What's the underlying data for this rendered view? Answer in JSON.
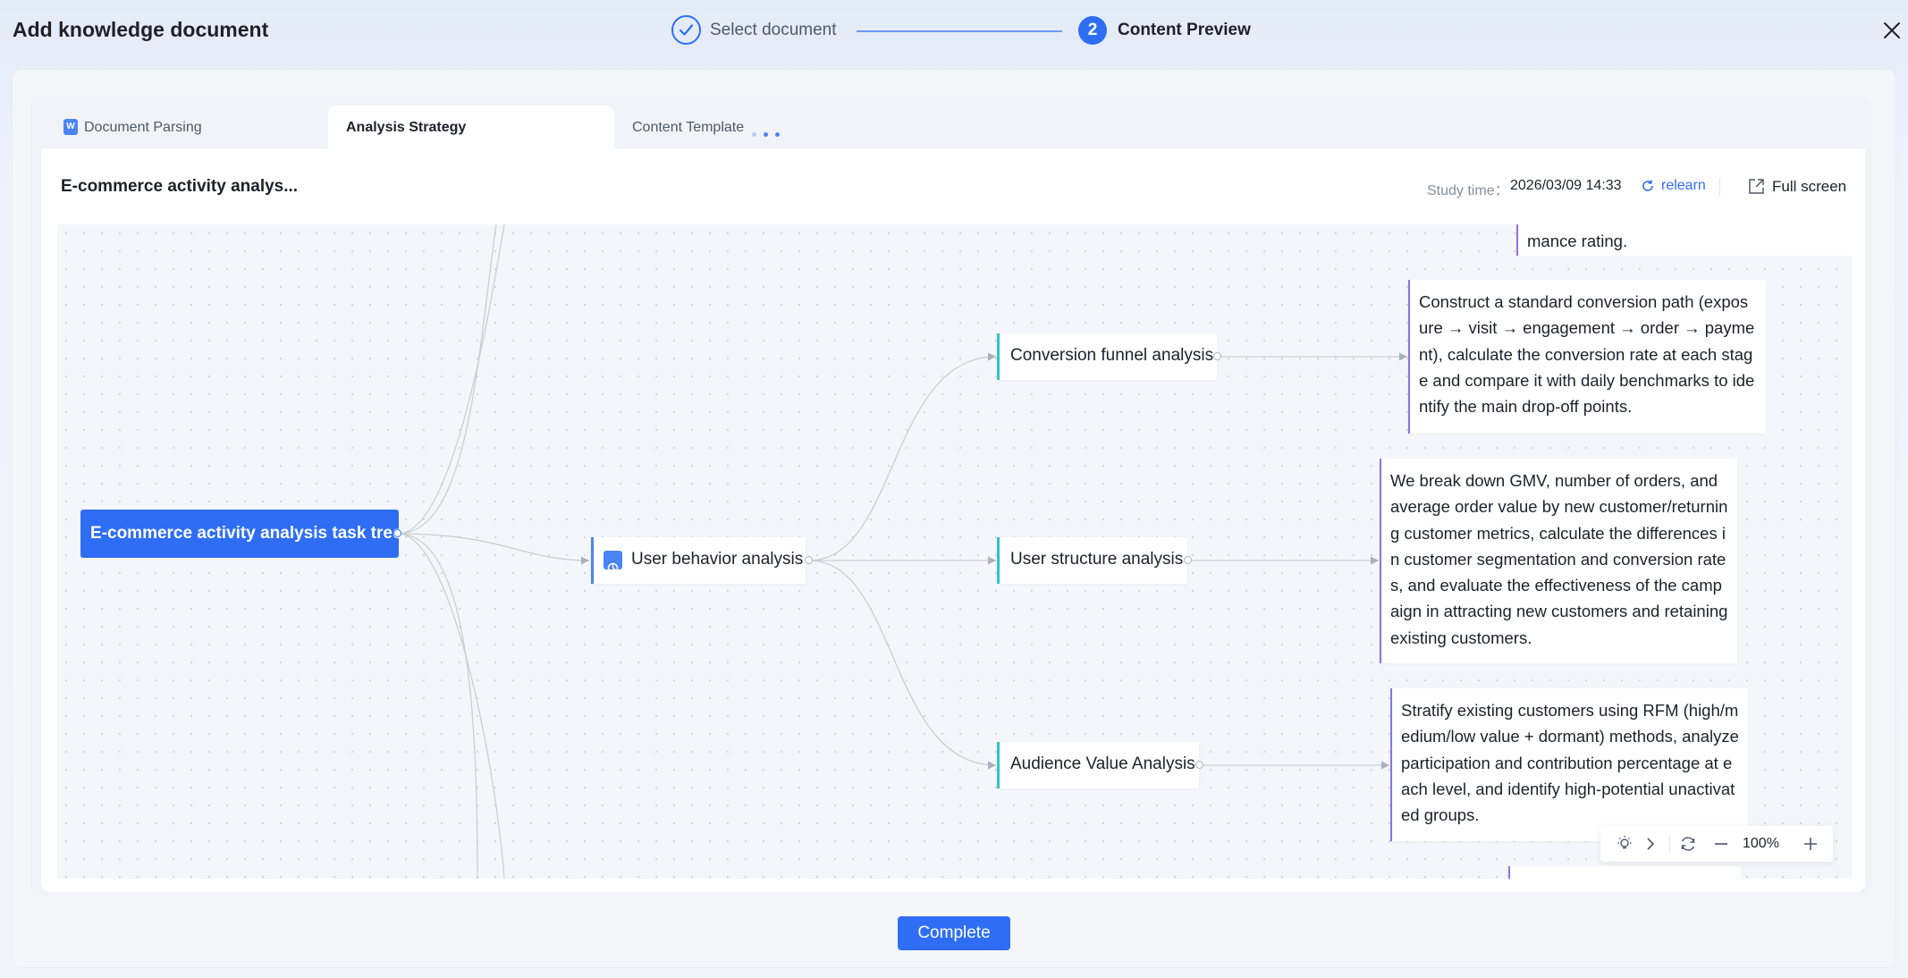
{
  "header": {
    "title": "Add knowledge document",
    "steps": [
      {
        "label": "Select document",
        "state": "done"
      },
      {
        "number": "2",
        "label": "Content Preview",
        "state": "active"
      }
    ]
  },
  "tabs": [
    {
      "label": "Document Parsing",
      "icon": "word-doc-icon",
      "icon_text": "W"
    },
    {
      "label": "Analysis Strategy",
      "active": true
    },
    {
      "label": "Content Template",
      "loading": true
    }
  ],
  "toolbar": {
    "document_title": "E-commerce activity analys...",
    "study_label": "Study time：",
    "study_time": "2026/03/09 14:33",
    "relearn": "relearn",
    "full_screen": "Full screen"
  },
  "tree": {
    "root": "E-commerce activity analysis task tree",
    "branch": "User behavior analysis",
    "children": [
      {
        "title": "Conversion funnel analysis",
        "description": "Construct a standard conversion path (exposure → visit → engagement → order → payment), calculate the conversion rate at each stage and compare it with daily benchmarks to identify the main drop-off points."
      },
      {
        "title": "User structure analysis",
        "description": "We break down GMV, number of orders, and average order value by new customer/returning customer metrics, calculate the differences in customer segmentation and conversion rates, and evaluate the effectiveness of the campaign in attracting new customers and retaining existing customers."
      },
      {
        "title": "Audience Value Analysis",
        "description": "Stratify existing customers using RFM (high/medium/low value + dormant) methods, analyze participation and contribution percentage at each level, and identify high-potential unactivated groups."
      }
    ],
    "partial_text_top": "mance rating."
  },
  "zoom": {
    "level": "100%"
  },
  "footer": {
    "complete": "Complete"
  },
  "colors": {
    "primary": "#2f6ef4",
    "teal_border": "#34c3c0",
    "purple_border": "#8a72e8"
  }
}
